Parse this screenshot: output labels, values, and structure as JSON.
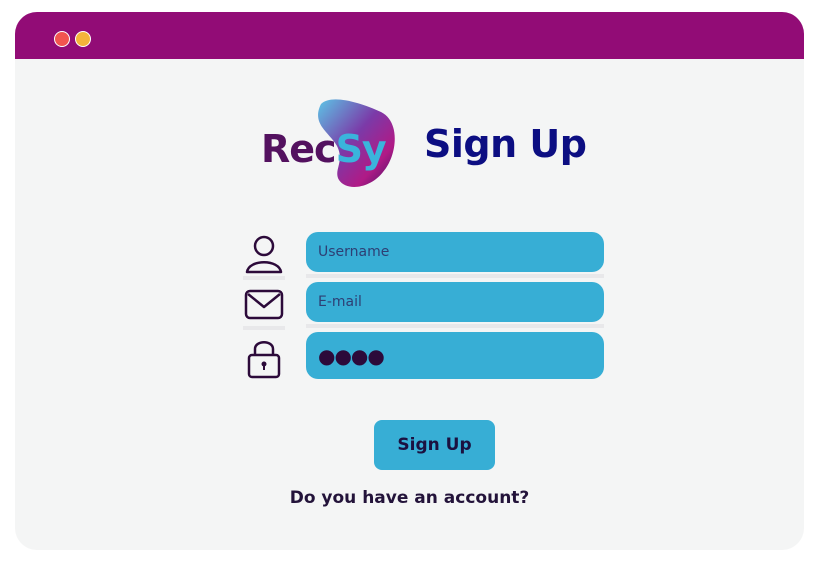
{
  "window": {
    "traffic_lights": [
      "close",
      "minimize"
    ],
    "colors": {
      "titlebar": "#920c76",
      "background": "#f4f5f5",
      "accent": "#37aed5",
      "title": "#0c0e82"
    }
  },
  "logo": {
    "part1": "Rec",
    "part2": "Sy"
  },
  "page": {
    "title": "Sign Up"
  },
  "form": {
    "username": {
      "placeholder": "Username",
      "icon": "user-icon"
    },
    "email": {
      "placeholder": "E-mail",
      "icon": "envelope-icon"
    },
    "password": {
      "value": "●●●●",
      "icon": "lock-icon"
    }
  },
  "actions": {
    "signup_label": "Sign Up",
    "account_link": "Do you have an account?"
  }
}
